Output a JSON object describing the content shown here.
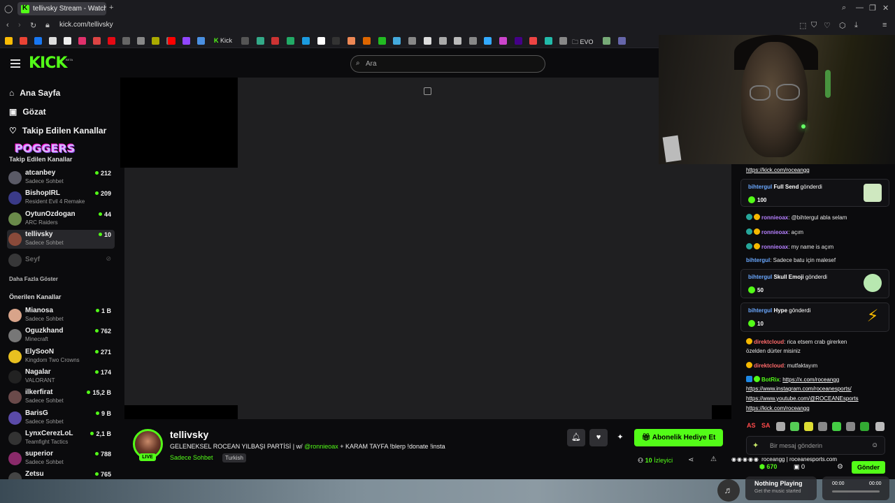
{
  "browser": {
    "tab_title": "tellivsky Stream - Watch L",
    "url": "kick.com/tellivsky",
    "bookmarks": [
      {
        "name": "google",
        "color": "#fbbc05"
      },
      {
        "name": "gmail",
        "color": "#ea4335"
      },
      {
        "name": "facebook",
        "color": "#1877f2"
      },
      {
        "name": "x",
        "color": "#dddddd"
      },
      {
        "name": "tiktok",
        "color": "#eeeeee"
      },
      {
        "name": "instagram",
        "color": "#e1306c"
      },
      {
        "name": "bookmark-7",
        "color": "#d44"
      },
      {
        "name": "netflix",
        "color": "#e50914"
      },
      {
        "name": "bookmark-9",
        "color": "#666"
      },
      {
        "name": "bookmark-10",
        "color": "#888"
      },
      {
        "name": "bookmark-11",
        "color": "#aa0"
      },
      {
        "name": "bookmark-12",
        "color": "#777"
      },
      {
        "name": "youtube",
        "color": "#ff0000"
      },
      {
        "name": "twitch",
        "color": "#9146ff"
      },
      {
        "name": "bookmark-15",
        "color": "#4a90e2"
      }
    ],
    "kick_bookmark": "Kick",
    "evo_bookmark": "EVO"
  },
  "header": {
    "logo": "KICK",
    "logo_badge": "BETA",
    "search_placeholder": "Ara"
  },
  "sidebar": {
    "nav": [
      {
        "icon": "home-icon",
        "label": "Ana Sayfa"
      },
      {
        "icon": "browse-icon",
        "label": "Gözat"
      },
      {
        "icon": "heart-icon",
        "label": "Takip Edilen Kanallar"
      }
    ],
    "poggers": "POGGERS",
    "followed_title": "Takip Edilen Kanallar",
    "followed": [
      {
        "name": "atcanbey",
        "sub": "Sadece Sohbet",
        "viewers": "212",
        "avatar": "#5a5a66"
      },
      {
        "name": "BishopIRL",
        "sub": "Resident Evil 4 Remake",
        "viewers": "209",
        "avatar": "#3a3a88"
      },
      {
        "name": "OytunOzdogan",
        "sub": "ARC Raiders",
        "viewers": "44",
        "avatar": "#6a8a4a"
      },
      {
        "name": "tellivsky",
        "sub": "Sadece Sohbet",
        "viewers": "10",
        "avatar": "#8a4a3a"
      }
    ],
    "offline_channel": "Seyf",
    "show_more": "Daha Fazla Göster",
    "recommended_title": "Önerilen Kanallar",
    "recommended": [
      {
        "name": "Mianosa",
        "sub": "Sadece Sohbet",
        "viewers": "1 B",
        "avatar": "#d8a48a"
      },
      {
        "name": "Oguzkhand",
        "sub": "Minecraft",
        "viewers": "762",
        "avatar": "#777777"
      },
      {
        "name": "ElySooN",
        "sub": "Kingdom Two Crowns",
        "viewers": "271",
        "avatar": "#e8c020"
      },
      {
        "name": "Nagalar",
        "sub": "VALORANT",
        "viewers": "174",
        "avatar": "#222222"
      },
      {
        "name": "ilkerfirat",
        "sub": "Sadece Sohbet",
        "viewers": "15,2 B",
        "avatar": "#6a4a4a"
      },
      {
        "name": "BarisG",
        "sub": "Sadece Sohbet",
        "viewers": "9 B",
        "avatar": "#5a4aa8"
      },
      {
        "name": "LynxCerezLoL",
        "sub": "Teamfight Tactics",
        "viewers": "2,1 B",
        "avatar": "#333333"
      },
      {
        "name": "superior",
        "sub": "Sadece Sohbet",
        "viewers": "788",
        "avatar": "#8a2a6a"
      },
      {
        "name": "Zetsu",
        "sub": "",
        "viewers": "765",
        "avatar": "#444444"
      }
    ]
  },
  "stream": {
    "name": "tellivsky",
    "live": "LIVE",
    "title_pre": "GELENEKSEL ROCEAN YILBAŞI PARTİSİ | w/ ",
    "title_mention": "@ronnieoax",
    "title_post": " + KARAM TAYFA !blerp !donate !insta",
    "category": "Sadece Sohbet",
    "language": "Turkish",
    "viewers": "10",
    "viewers_label": "İzleyici",
    "gift_button": "Abonelik Hediye Et"
  },
  "chat": {
    "top_link": "https://kick.com/roceangg",
    "card1": {
      "user": "bihtergul",
      "action": "Full Send",
      "suffix": " gönderdi",
      "amount": "100"
    },
    "msgs1": [
      {
        "user": "ronnieoax",
        "text": ": @bihtergul abla selam"
      },
      {
        "user": "ronnieoax",
        "text": ": açım"
      },
      {
        "user": "ronnieoax",
        "text": ": my name is açım"
      }
    ],
    "msg_bihter": {
      "user": "bihtergul",
      "text": ": Sadece batu için malesef"
    },
    "card2": {
      "user": "bihtergul",
      "action": "Skull Emoji",
      "suffix": " gönderdi",
      "amount": "50"
    },
    "card3": {
      "user": "bihtergul",
      "action": "Hype",
      "suffix": " gönderdi",
      "amount": "10"
    },
    "direkt1_user": "direktcloud",
    "direkt1_text": ": rica etsem crab girerken",
    "direkt1_text2": "özelden dürter misiniz",
    "direkt2_user": "direktcloud",
    "direkt2_text": ": mutfaktayım",
    "bot_user": "BotRix",
    "bot_links": [
      "https://x.com/roceangg",
      "https://www.instagram.com/roceanesports/",
      "https://www.youtube.com/@ROCEANEsports",
      "https://kick.com/roceangg"
    ],
    "emotes": [
      "AS",
      "SA"
    ],
    "input_placeholder": "Bir mesaj gönderin",
    "send_button": "Gönder",
    "points": "670",
    "gifts": "0",
    "overlay_text": "roceangg | roceanesports.com"
  },
  "taskbar": {
    "now_playing": "Nothing Playing",
    "now_playing_sub": "Get the music started",
    "time_start": "00:00",
    "time_end": "00:00"
  }
}
